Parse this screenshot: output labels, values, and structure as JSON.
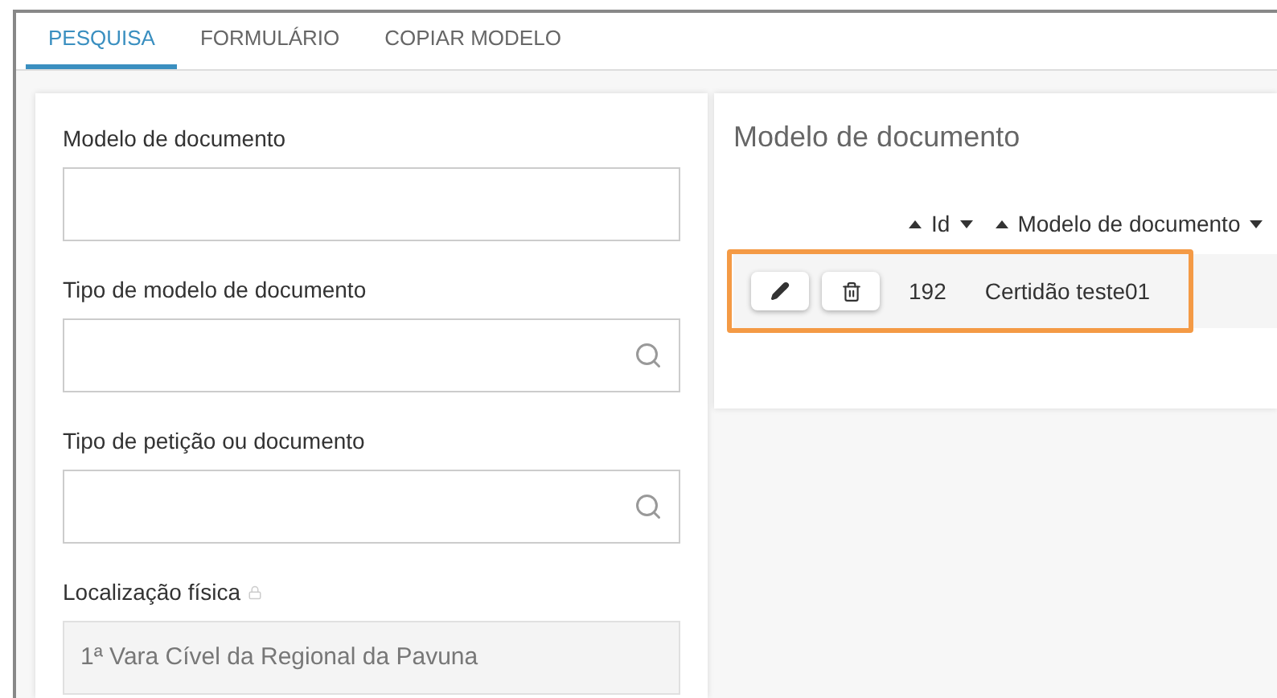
{
  "tabs": [
    {
      "label": "PESQUISA",
      "selected": true
    },
    {
      "label": "FORMULÁRIO",
      "selected": false
    },
    {
      "label": "COPIAR MODELO",
      "selected": false
    }
  ],
  "form": {
    "fields": [
      {
        "label": "Modelo de documento",
        "kind": "text",
        "locked": false
      },
      {
        "label": "Tipo de modelo de documento",
        "kind": "search",
        "locked": false
      },
      {
        "label": "Tipo de petição ou documento",
        "kind": "search",
        "locked": false
      },
      {
        "label": "Localização física",
        "kind": "text",
        "locked": true,
        "value": "1ª Vara Cível da Regional da Pavuna"
      }
    ]
  },
  "results": {
    "title": "Modelo de documento",
    "columns": [
      "Id",
      "Modelo de documento"
    ],
    "rows": [
      {
        "id": "192",
        "model": "Certidão teste01",
        "highlighted": true
      }
    ]
  }
}
